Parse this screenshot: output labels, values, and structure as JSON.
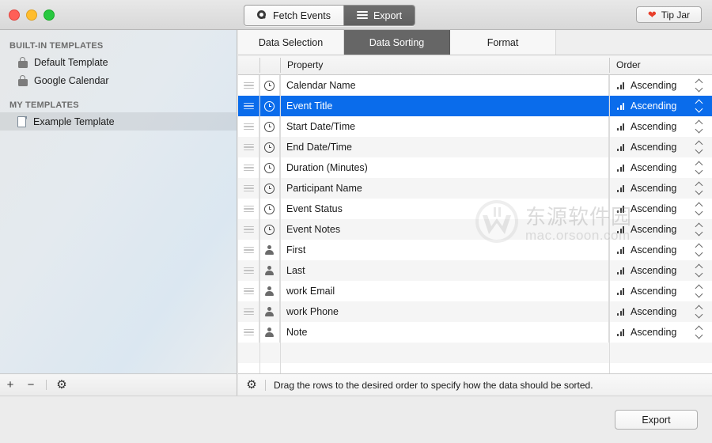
{
  "window": {
    "traffic_lights": [
      "close",
      "minimize",
      "maximize"
    ],
    "colors": {
      "close": "#ff5f57",
      "minimize": "#ffbd2e",
      "maximize": "#28c840",
      "selection_blue": "#0a6ceb",
      "tab_active": "#666666",
      "heart_red": "#e8402c"
    }
  },
  "toolbar": {
    "segments": [
      {
        "label": "Fetch Events",
        "icon": "search-icon",
        "active": false
      },
      {
        "label": "Export",
        "icon": "list-icon",
        "active": true
      }
    ],
    "tip_jar": {
      "label": "Tip Jar",
      "icon": "heart-icon"
    }
  },
  "sidebar": {
    "sections": [
      {
        "header": "BUILT-IN TEMPLATES",
        "items": [
          {
            "label": "Default Template",
            "icon": "lock-icon",
            "selected": false
          },
          {
            "label": "Google Calendar",
            "icon": "lock-icon",
            "selected": false
          }
        ]
      },
      {
        "header": "MY TEMPLATES",
        "items": [
          {
            "label": "Example Template",
            "icon": "document-icon",
            "selected": true
          }
        ]
      }
    ],
    "footer": {
      "add_label": "+",
      "remove_label": "−",
      "settings_icon": "gear-icon"
    }
  },
  "main": {
    "tabs": [
      {
        "label": "Data Selection",
        "active": false
      },
      {
        "label": "Data Sorting",
        "active": true
      },
      {
        "label": "Format",
        "active": false
      }
    ],
    "table": {
      "columns": [
        "Property",
        "Order"
      ],
      "rows": [
        {
          "property": "Calendar Name",
          "icon": "clock-icon",
          "order": "Ascending",
          "selected": false
        },
        {
          "property": "Event Title",
          "icon": "clock-icon",
          "order": "Ascending",
          "selected": true
        },
        {
          "property": "Start Date/Time",
          "icon": "clock-icon",
          "order": "Ascending",
          "selected": false
        },
        {
          "property": "End Date/Time",
          "icon": "clock-icon",
          "order": "Ascending",
          "selected": false
        },
        {
          "property": "Duration (Minutes)",
          "icon": "clock-icon",
          "order": "Ascending",
          "selected": false
        },
        {
          "property": "Participant Name",
          "icon": "clock-icon",
          "order": "Ascending",
          "selected": false
        },
        {
          "property": "Event Status",
          "icon": "clock-icon",
          "order": "Ascending",
          "selected": false
        },
        {
          "property": "Event Notes",
          "icon": "clock-icon",
          "order": "Ascending",
          "selected": false
        },
        {
          "property": "First",
          "icon": "person-icon",
          "order": "Ascending",
          "selected": false
        },
        {
          "property": "Last",
          "icon": "person-icon",
          "order": "Ascending",
          "selected": false
        },
        {
          "property": "work Email",
          "icon": "person-icon",
          "order": "Ascending",
          "selected": false
        },
        {
          "property": "work Phone",
          "icon": "person-icon",
          "order": "Ascending",
          "selected": false
        },
        {
          "property": "Note",
          "icon": "person-icon",
          "order": "Ascending",
          "selected": false
        }
      ]
    },
    "footer": {
      "settings_icon": "gear-icon",
      "hint": "Drag the rows to the desired order to specify how the data should be sorted."
    }
  },
  "bottom": {
    "export_label": "Export"
  },
  "watermark": {
    "chinese_text": "东源软件园",
    "url": "mac.orsoon.com"
  }
}
